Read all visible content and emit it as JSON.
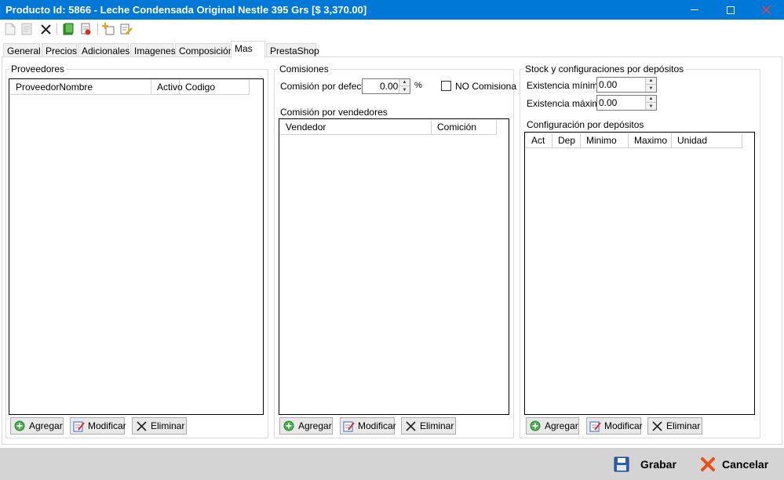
{
  "window": {
    "title": "Producto Id: 5866 - Leche Condensada Original Nestle 395 Grs [$ 3,370.00]",
    "controls": [
      "minimize-icon",
      "maximize-icon",
      "close-icon"
    ]
  },
  "toolbar": {
    "icons": [
      "new-icon",
      "edit-icon",
      "delete-icon",
      "book-icon",
      "report-icon",
      "add-item-icon",
      "edit-item-icon"
    ]
  },
  "tabs": [
    "General",
    "Precios",
    "Adicionales",
    "Imagenes",
    "Composición",
    "Mas",
    "PrestaShop"
  ],
  "active_tab": "Mas",
  "proveedores": {
    "title": "Proveedores",
    "columns": [
      "ProveedorNombre",
      "Activo",
      "Codigo"
    ],
    "rows": []
  },
  "comisiones": {
    "title": "Comisiones",
    "default_label": "Comisión por defecto",
    "default_value": "0.00",
    "percent": "%",
    "no_comisiona_label": "NO Comisiona",
    "no_comisiona_checked": false,
    "vendedores_title": "Comisión por vendedores",
    "columns": [
      "Vendedor",
      "Comición"
    ],
    "rows": []
  },
  "stock": {
    "title": "Stock y configuraciones por depósitos",
    "min_label": "Existencia mínima",
    "min_value": "0.00",
    "max_label": "Existencia máxima",
    "max_value": "0.00",
    "config_title": "Configuración por depósitos",
    "columns": [
      "Act",
      "Dep",
      "Minimo",
      "Maximo",
      "Unidad"
    ],
    "rows": []
  },
  "buttons": {
    "add": "Agregar",
    "modify": "Modificar",
    "delete": "Eliminar"
  },
  "footer": {
    "save": "Grabar",
    "cancel": "Cancelar"
  },
  "colors": {
    "titlebar": "#0078d7",
    "footer": "#d4d4d4"
  }
}
